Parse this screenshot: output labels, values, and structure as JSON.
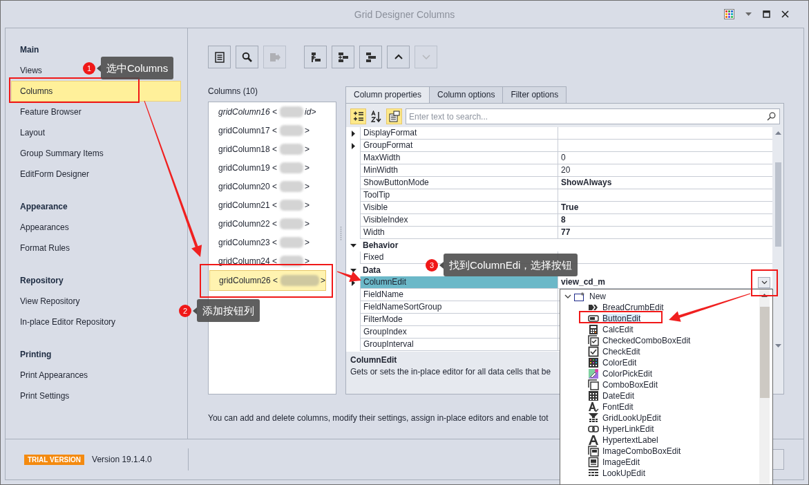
{
  "window": {
    "title": "Grid Designer Columns"
  },
  "sidebar": {
    "groups": [
      {
        "title": "Main",
        "items": [
          {
            "label": "Views",
            "selected": false
          },
          {
            "label": "Columns",
            "selected": true
          },
          {
            "label": "Feature Browser",
            "selected": false
          },
          {
            "label": "Layout",
            "selected": false
          },
          {
            "label": "Group Summary Items",
            "selected": false
          },
          {
            "label": "EditForm Designer",
            "selected": false
          }
        ]
      },
      {
        "title": "Appearance",
        "items": [
          {
            "label": "Appearances",
            "selected": false
          },
          {
            "label": "Format Rules",
            "selected": false
          }
        ]
      },
      {
        "title": "Repository",
        "items": [
          {
            "label": "View Repository",
            "selected": false
          },
          {
            "label": "In-place Editor Repository",
            "selected": false
          }
        ]
      },
      {
        "title": "Printing",
        "items": [
          {
            "label": "Print Appearances",
            "selected": false
          },
          {
            "label": "Print Settings",
            "selected": false
          }
        ]
      }
    ]
  },
  "toolbar": [
    {
      "disabled": false
    },
    {
      "disabled": false
    },
    {
      "disabled": true
    },
    {
      "disabled": false
    },
    {
      "disabled": false
    },
    {
      "disabled": false
    },
    {
      "disabled": false
    },
    {
      "disabled": true
    }
  ],
  "columns": {
    "label": "Columns (10)",
    "items": [
      {
        "name": "gridColumn16 <",
        "tail": "id>",
        "visible": false,
        "selected": false
      },
      {
        "name": "gridColumn17 <",
        "tail": ">",
        "visible": true,
        "selected": false
      },
      {
        "name": "gridColumn18 <",
        "tail": ">",
        "visible": true,
        "selected": false
      },
      {
        "name": "gridColumn19 <",
        "tail": ">",
        "visible": true,
        "selected": false
      },
      {
        "name": "gridColumn20 <",
        "tail": ">",
        "visible": true,
        "selected": false
      },
      {
        "name": "gridColumn21 <",
        "tail": ">",
        "visible": true,
        "selected": false
      },
      {
        "name": "gridColumn22 <",
        "tail": ">",
        "visible": true,
        "selected": false
      },
      {
        "name": "gridColumn23 <",
        "tail": ">",
        "visible": true,
        "selected": false
      },
      {
        "name": "gridColumn24 <",
        "tail": ">",
        "visible": true,
        "selected": false
      },
      {
        "name": "gridColumn26 <",
        "tail": ">",
        "visible": true,
        "selected": true
      }
    ]
  },
  "tabs": [
    {
      "label": "Column properties",
      "selected": true
    },
    {
      "label": "Column options",
      "selected": false
    },
    {
      "label": "Filter options",
      "selected": false
    }
  ],
  "property_grid": {
    "tools": [
      {
        "selected": true
      },
      {
        "selected": false
      },
      {
        "selected": true
      }
    ],
    "search": {
      "placeholder": "Enter text to search..."
    },
    "rows": [
      {
        "kind": "property",
        "name": "DisplayFormat",
        "expandable": true,
        "selected": false
      },
      {
        "kind": "property",
        "name": "GroupFormat",
        "expandable": true,
        "selected": false
      },
      {
        "kind": "property",
        "name": "MaxWidth",
        "value": "0",
        "expandable": false,
        "modified": false,
        "selected": false
      },
      {
        "kind": "property",
        "name": "MinWidth",
        "value": "20",
        "expandable": false,
        "modified": false,
        "selected": false
      },
      {
        "kind": "property",
        "name": "ShowButtonMode",
        "value": "ShowAlways",
        "expandable": false,
        "modified": true,
        "selected": false
      },
      {
        "kind": "property",
        "name": "ToolTip",
        "expandable": false,
        "selected": false
      },
      {
        "kind": "property",
        "name": "Visible",
        "value": "True",
        "expandable": false,
        "modified": true,
        "selected": false
      },
      {
        "kind": "property",
        "name": "VisibleIndex",
        "value": "8",
        "expandable": false,
        "modified": true,
        "selected": false
      },
      {
        "kind": "property",
        "name": "Width",
        "value": "77",
        "expandable": false,
        "modified": true,
        "selected": false
      },
      {
        "kind": "category",
        "name": "Behavior",
        "expanded": true
      },
      {
        "kind": "property",
        "name": "Fixed",
        "expandable": false,
        "selected": false
      },
      {
        "kind": "category",
        "name": "Data",
        "expanded": true
      },
      {
        "kind": "property",
        "name": "ColumnEdit",
        "value": "view_cd_m",
        "expandable": true,
        "modified": true,
        "selected": true
      },
      {
        "kind": "property",
        "name": "FieldName",
        "expandable": false,
        "selected": false
      },
      {
        "kind": "property",
        "name": "FieldNameSortGroup",
        "expandable": false,
        "selected": false
      },
      {
        "kind": "property",
        "name": "FilterMode",
        "expandable": false,
        "selected": false
      },
      {
        "kind": "property",
        "name": "GroupIndex",
        "expandable": false,
        "selected": false
      },
      {
        "kind": "property",
        "name": "GroupInterval",
        "expandable": false,
        "selected": false
      }
    ]
  },
  "description": {
    "title": "ColumnEdit",
    "text": "Gets or sets the in-place editor for all data cells that be"
  },
  "hint": "You can add and delete columns, modify their settings, assign in-place editors and enable tot",
  "footer": {
    "badge": "TRIAL VERSION",
    "version": "Version 19.1.4.0"
  },
  "editor_dropdown": {
    "label": "New",
    "expanded": true,
    "children": [
      {
        "label": "BreadCrumbEdit",
        "selected": false
      },
      {
        "label": "ButtonEdit",
        "selected": true
      },
      {
        "label": "CalcEdit",
        "selected": false
      },
      {
        "label": "CheckedComboBoxEdit",
        "selected": false
      },
      {
        "label": "CheckEdit",
        "selected": false
      },
      {
        "label": "ColorEdit",
        "selected": false
      },
      {
        "label": "ColorPickEdit",
        "selected": false
      },
      {
        "label": "ComboBoxEdit",
        "selected": false
      },
      {
        "label": "DateEdit",
        "selected": false
      },
      {
        "label": "FontEdit",
        "selected": false
      },
      {
        "label": "GridLookUpEdit",
        "selected": false
      },
      {
        "label": "HyperLinkEdit",
        "selected": false
      },
      {
        "label": "HypertextLabel",
        "selected": false
      },
      {
        "label": "ImageComboBoxEdit",
        "selected": false
      },
      {
        "label": "ImageEdit",
        "selected": false
      },
      {
        "label": "LookUpEdit",
        "selected": false
      }
    ]
  },
  "annotations": [
    {
      "number": "1",
      "text": "选中Columns"
    },
    {
      "number": "2",
      "text": "添加按钮列"
    },
    {
      "number": "3",
      "text": "找到ColumnEdi，选择按钮"
    }
  ]
}
